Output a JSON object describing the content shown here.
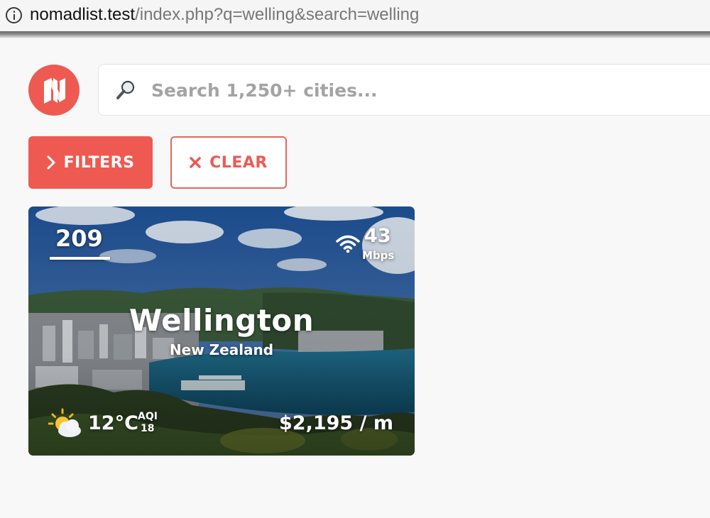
{
  "browser": {
    "url_host": "nomadlist.test",
    "url_path": "/index.php?q=welling&search=welling"
  },
  "search": {
    "placeholder": "Search 1,250+ cities..."
  },
  "filters_button": {
    "label": "FILTERS"
  },
  "clear_button": {
    "label": "CLEAR"
  },
  "city_card": {
    "rank": "209",
    "internet_speed": "43",
    "internet_unit": "Mbps",
    "city": "Wellington",
    "country": "New Zealand",
    "temperature": "12°C",
    "aqi_label": "AQI",
    "aqi_value": "18",
    "cost": "$2,195 / m"
  },
  "icons": {
    "info": "info-icon",
    "logo": "nomadlist-logo",
    "search": "magnifier-icon",
    "filters": "chevron-right-icon",
    "clear": "close-icon",
    "wifi": "wifi-icon",
    "weather": "sun-cloud-icon"
  },
  "colors": {
    "accent": "#ee5a51",
    "background": "#f8f8f8"
  }
}
